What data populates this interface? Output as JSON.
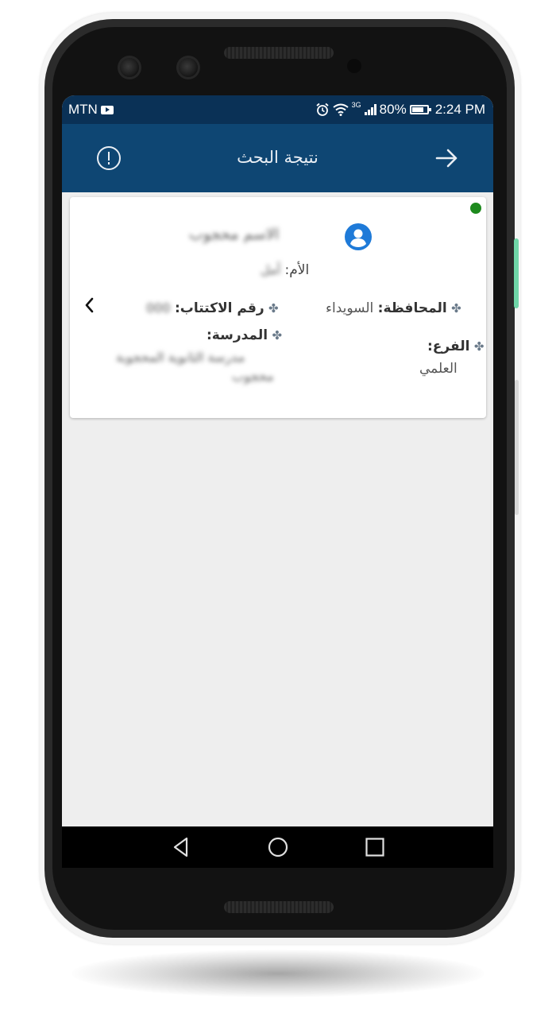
{
  "status_bar": {
    "carrier": "MTN",
    "network": "3G",
    "battery": "80%",
    "time": "2:24 PM"
  },
  "app_bar": {
    "title": "نتيجة البحث"
  },
  "card": {
    "student_name": "الاسم محجوب",
    "mother_label": "الأم:",
    "mother_value": "أمل",
    "province_label": "المحافظة:",
    "province_value": "السويداء",
    "exam_number_label": "رقم الاكتتاب:",
    "exam_number_value": "000",
    "branch_label": "الفرع:",
    "branch_value": "العلمي",
    "school_label": "المدرسة:",
    "school_value_line1": "مدرسة الثانوية المحجوبة",
    "school_value_line2": "محجوب"
  },
  "colors": {
    "status_bar": "#0a3156",
    "app_bar": "#0e4673",
    "avatar": "#1e7ad8",
    "online_dot": "#1e8a1e"
  },
  "icons": {
    "info": "info-circle-icon",
    "back": "arrow-right-icon",
    "avatar": "account-circle-icon",
    "chevron": "chevron-left-icon",
    "nav_back": "triangle-back-icon",
    "nav_home": "circle-home-icon",
    "nav_recents": "square-recents-icon"
  }
}
